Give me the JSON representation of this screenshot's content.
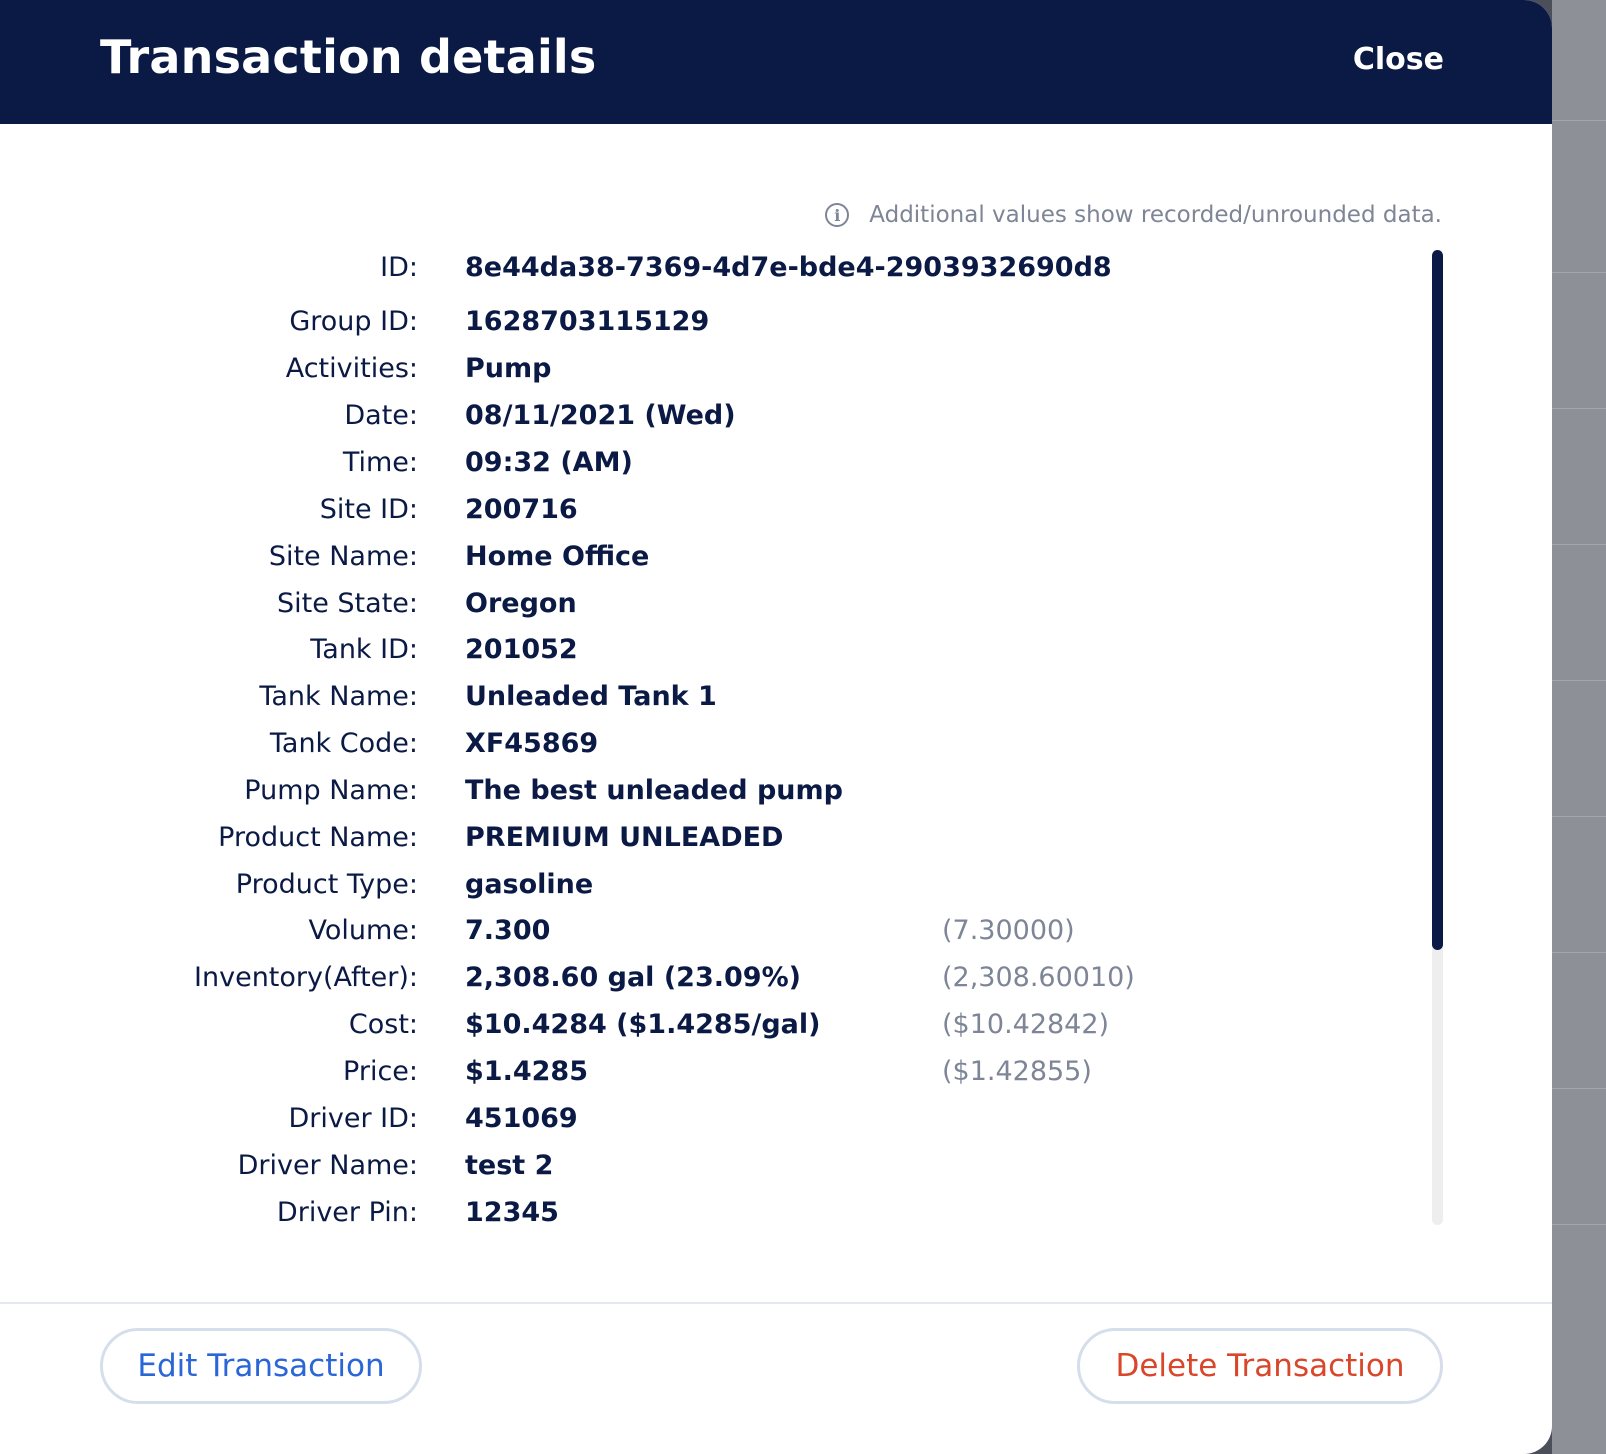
{
  "header": {
    "title": "Transaction details",
    "close_label": "Close"
  },
  "info_note": {
    "icon": "info-icon",
    "text": "Additional values show recorded/unrounded data."
  },
  "details": [
    {
      "label": "ID:",
      "value": "8e44da38-7369-4d7e-bde4-2903932690d8",
      "raw": ""
    },
    {
      "label": "Group ID:",
      "value": "1628703115129",
      "raw": ""
    },
    {
      "label": "Activities:",
      "value": "Pump",
      "raw": ""
    },
    {
      "label": "Date:",
      "value": "08/11/2021 (Wed)",
      "raw": ""
    },
    {
      "label": "Time:",
      "value": "09:32 (AM)",
      "raw": ""
    },
    {
      "label": "Site ID:",
      "value": "200716",
      "raw": ""
    },
    {
      "label": "Site Name:",
      "value": "Home Office",
      "raw": ""
    },
    {
      "label": "Site State:",
      "value": "Oregon",
      "raw": ""
    },
    {
      "label": "Tank ID:",
      "value": "201052",
      "raw": ""
    },
    {
      "label": "Tank Name:",
      "value": "Unleaded Tank 1",
      "raw": ""
    },
    {
      "label": "Tank Code:",
      "value": "XF45869",
      "raw": ""
    },
    {
      "label": "Pump Name:",
      "value": "The best unleaded pump",
      "raw": ""
    },
    {
      "label": "Product Name:",
      "value": "PREMIUM UNLEADED",
      "raw": ""
    },
    {
      "label": "Product Type:",
      "value": "gasoline",
      "raw": ""
    },
    {
      "label": "Volume:",
      "value": "7.300",
      "raw": "(7.30000)"
    },
    {
      "label": "Inventory(After):",
      "value": "2,308.60 gal (23.09%)",
      "raw": "(2,308.60010)"
    },
    {
      "label": "Cost:",
      "value": "$10.4284 ($1.4285/gal)",
      "raw": "($10.42842)"
    },
    {
      "label": "Price:",
      "value": "$1.4285",
      "raw": "($1.42855)"
    },
    {
      "label": "Driver ID:",
      "value": "451069",
      "raw": ""
    },
    {
      "label": "Driver Name:",
      "value": "test 2",
      "raw": ""
    },
    {
      "label": "Driver Pin:",
      "value": "12345",
      "raw": ""
    }
  ],
  "footer": {
    "edit_label": "Edit Transaction",
    "delete_label": "Delete Transaction"
  },
  "colors": {
    "header_bg": "#0b1a45",
    "edit_text": "#2a66d6",
    "delete_text": "#d9472b",
    "muted_text": "#7d8596"
  }
}
